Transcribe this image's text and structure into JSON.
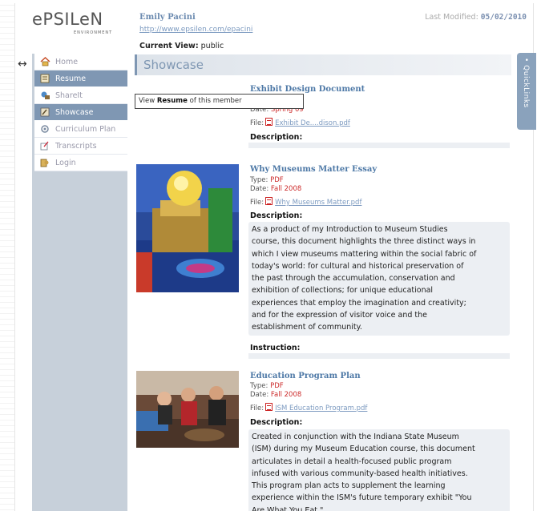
{
  "header": {
    "logo_main": "ePSILeN",
    "logo_sub": "ENVIRONMENT",
    "owner_name": "Emily Pacini",
    "owner_url": "http://www.epsilen.com/epacini",
    "current_view_label": "Current View:",
    "current_view_value": "public",
    "last_modified_label": "Last Modified:",
    "last_modified_value": "05/02/2010"
  },
  "sidebar": {
    "items": [
      {
        "label": "Home",
        "icon": "home-icon"
      },
      {
        "label": "Resume",
        "icon": "resume-icon"
      },
      {
        "label": "ShareIt",
        "icon": "share-icon"
      },
      {
        "label": "Showcase",
        "icon": "showcase-icon"
      },
      {
        "label": "Curriculum Plan",
        "icon": "curriculum-icon"
      },
      {
        "label": "Transcripts",
        "icon": "transcripts-icon"
      },
      {
        "label": "Login",
        "icon": "login-icon"
      }
    ],
    "tooltip_prefix": "View",
    "tooltip_bold": "Resume",
    "tooltip_suffix": "of this member"
  },
  "main": {
    "section_title": "Showcase",
    "quicklinks_label": "• QuickLinks",
    "items": [
      {
        "title": "Exhibit Design Document",
        "date_label": "Date:",
        "date_value": "Spring 09",
        "file_label": "File:",
        "file_name": "Exhibit De....dison.pdf",
        "description_label": "Description:"
      },
      {
        "title": "Why Museums Matter Essay",
        "type_label": "Type:",
        "type_value": "PDF",
        "date_label": "Date:",
        "date_value": "Fall 2008",
        "file_label": "File:",
        "file_name": "Why Museums Matter.pdf",
        "description_label": "Description:",
        "description_lines": [
          "As a product of my Introduction to Museum Studies",
          "course, this document highlights the three distinct ways in",
          "which I view museums mattering within the social fabric of",
          "today's world: for cultural and historical preservation of",
          "the past through the accumulation, conservation and",
          "exhibition of collections; for unique educational",
          "experiences that employ the imagination and creativity;",
          "and for the expression of visitor voice and the",
          "establishment of community."
        ],
        "instruction_label": "Instruction:"
      },
      {
        "title": "Education Program Plan",
        "type_label": "Type:",
        "type_value": "PDF",
        "date_label": "Date:",
        "date_value": "Fall 2008",
        "file_label": "File:",
        "file_name": "ISM Education Program.pdf",
        "description_label": "Description:",
        "description_lines": [
          "Created in conjunction with the Indiana State Museum",
          "(ISM) during my Museum Education course, this document",
          "articulates in detail a health-focused public program",
          "infused with various community-based health initiatives.",
          "This program plan acts to supplement the learning",
          "experience within the ISM's future temporary exhibit \"You",
          "Are What You Eat.\""
        ]
      }
    ]
  }
}
